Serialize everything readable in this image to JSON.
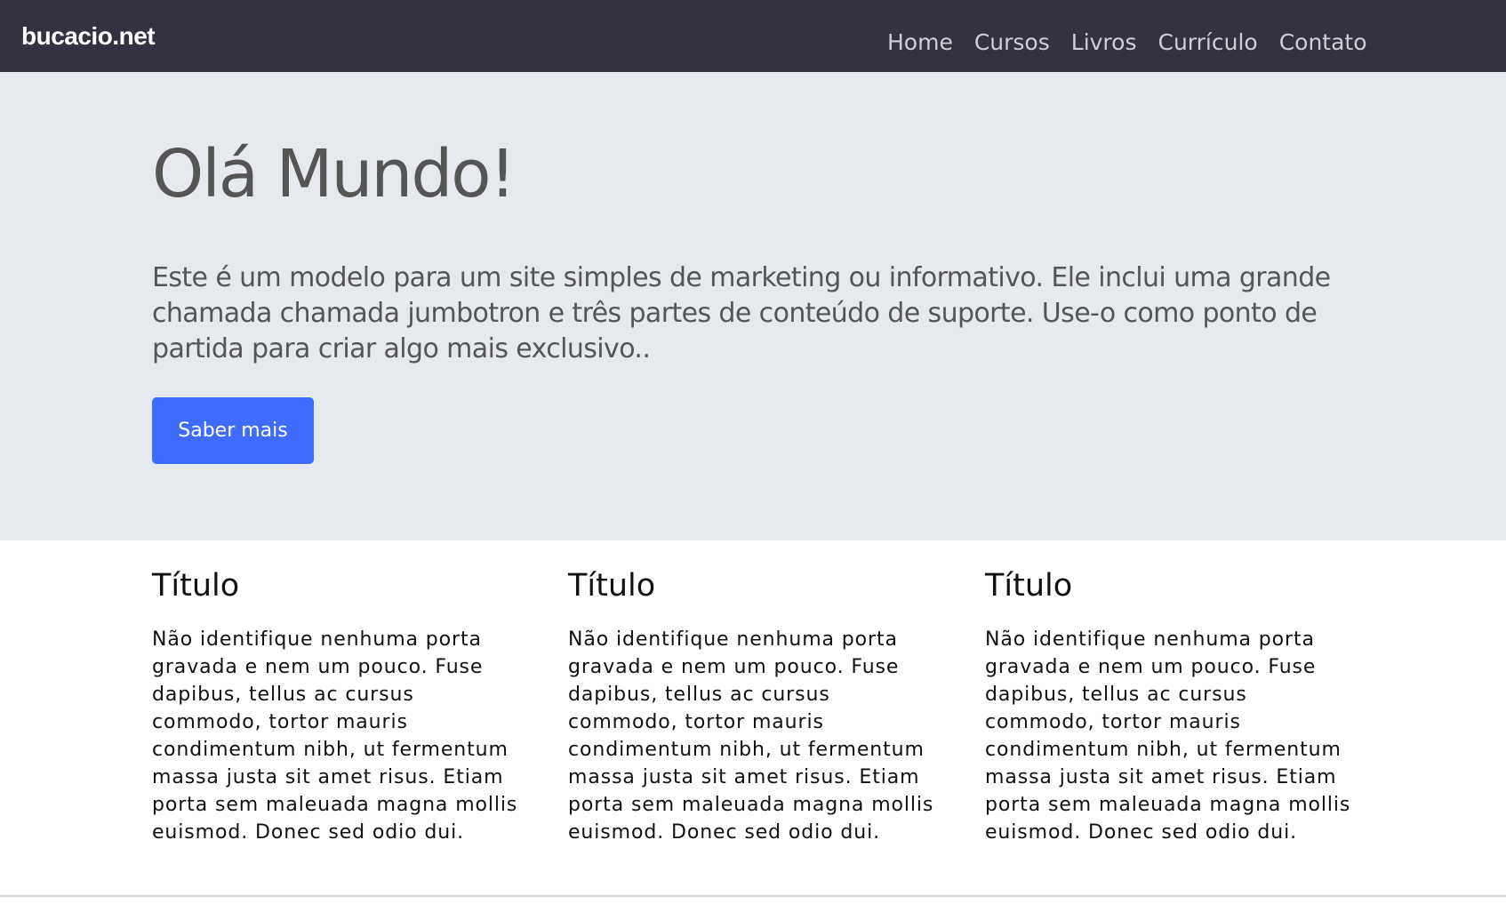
{
  "navbar": {
    "brand": "bucacio.net",
    "links": [
      {
        "label": "Home"
      },
      {
        "label": "Cursos"
      },
      {
        "label": "Livros"
      },
      {
        "label": "Currículo"
      },
      {
        "label": "Contato"
      }
    ]
  },
  "hero": {
    "title": "Olá Mundo!",
    "lead": "Este é um modelo para um site simples de marketing ou informativo. Ele inclui uma grande chamada chamada jumbotron e três partes de conteúdo de suporte. Use-o como ponto de partida para criar algo mais exclusivo..",
    "button_label": "Saber mais"
  },
  "features": [
    {
      "title": "Título",
      "body": "Não identifique nenhuma porta gravada e nem um pouco. Fuse dapibus, tellus ac cursus commodo, tortor mauris condimentum nibh, ut fermentum massa justa sit amet risus. Etiam porta sem maleuada magna mollis euismod. Donec sed odio dui."
    },
    {
      "title": "Título",
      "body": "Não identifique nenhuma porta gravada e nem um pouco. Fuse dapibus, tellus ac cursus commodo, tortor mauris condimentum nibh, ut fermentum massa justa sit amet risus. Etiam porta sem maleuada magna mollis euismod. Donec sed odio dui."
    },
    {
      "title": "Título",
      "body": "Não identifique nenhuma porta gravada e nem um pouco. Fuse dapibus, tellus ac cursus commodo, tortor mauris condimentum nibh, ut fermentum massa justa sit amet risus. Etiam porta sem maleuada magna mollis euismod. Donec sed odio dui."
    }
  ],
  "colors": {
    "navbar_bg": "#343140",
    "jumbotron_bg": "#e6e9ee",
    "primary": "#3f6cfe"
  }
}
